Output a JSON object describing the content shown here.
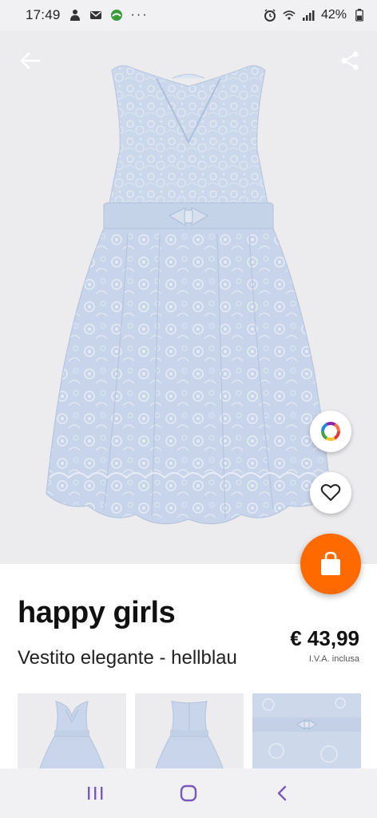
{
  "status_bar": {
    "time": "17:49",
    "battery": "42%",
    "left_icons": [
      "person-icon",
      "mail-icon",
      "app-icon",
      "more-dots-icon"
    ],
    "right_icons": [
      "alarm-icon",
      "wifi-icon",
      "signal-icon",
      "battery-icon"
    ]
  },
  "product": {
    "brand": "happy girls",
    "name": "Vestito elegante - hellblau",
    "price": "€ 43,99",
    "vat_note": "I.V.A. inclusa"
  },
  "hero": {
    "icons": [
      "back-arrow-icon",
      "share-icon",
      "color-wheel-icon",
      "heart-icon",
      "shopping-bag-icon"
    ]
  },
  "thumbnails": [
    {
      "view": "front"
    },
    {
      "view": "back"
    },
    {
      "view": "detail"
    }
  ],
  "nav_bar": {
    "icons": [
      "recent-apps-icon",
      "home-icon",
      "back-icon"
    ]
  },
  "colors": {
    "accent": "#ff6a00",
    "dress": "#cad6ea",
    "background": "#ececee"
  }
}
